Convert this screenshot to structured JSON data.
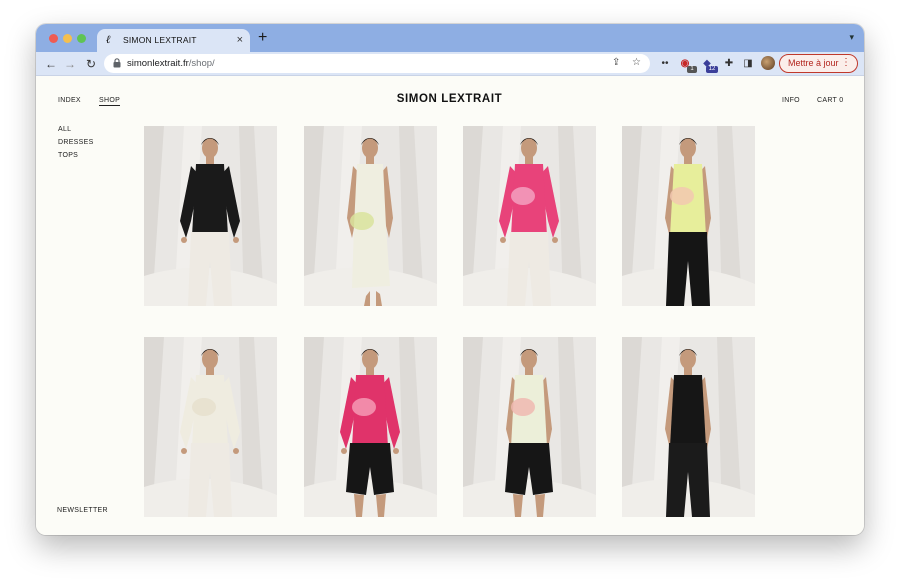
{
  "browser": {
    "tab_title": "SIMON LEXTRAIT",
    "url_host": "simonlextrait.fr",
    "url_path": "/shop/",
    "update_label": "Mettre à jour",
    "extension_badges": [
      "1",
      "12"
    ]
  },
  "site": {
    "logo": "SIMON LEXTRAIT",
    "nav_left": [
      "INDEX",
      "SHOP"
    ],
    "nav_right": [
      "INFO",
      "CART 0"
    ],
    "categories": [
      "ALL",
      "DRESSES",
      "TOPS"
    ],
    "newsletter": "NEWSLETTER"
  },
  "products": [
    {
      "top": "black long-sleeve top",
      "bottom": "white trousers",
      "top_color": "#1a1a1a",
      "bottom_color": "#eeeae3",
      "accent": null
    },
    {
      "top": "cream sleeveless dress",
      "bottom": "",
      "top_color": "#efeee0",
      "bottom_color": "#efeee0",
      "accent": "#d9e39c"
    },
    {
      "top": "pink long-sleeve top",
      "bottom": "white trousers",
      "top_color": "#e8437a",
      "bottom_color": "#eeeae3",
      "accent": "#f3a0c0"
    },
    {
      "top": "yellow-green tank top",
      "bottom": "black trousers",
      "top_color": "#e7ee9b",
      "bottom_color": "#151515",
      "accent": "#f2c8b0"
    },
    {
      "top": "cream long-sleeve top",
      "bottom": "white trousers",
      "top_color": "#efece0",
      "bottom_color": "#eeeae3",
      "accent": "#e6e0cc"
    },
    {
      "top": "magenta long-sleeve top",
      "bottom": "black shorts",
      "top_color": "#e0336a",
      "bottom_color": "#161616",
      "accent": "#f49ab4"
    },
    {
      "top": "cream tank top",
      "bottom": "black shorts",
      "top_color": "#ecefd9",
      "bottom_color": "#161616",
      "accent": "#f0b8b0"
    },
    {
      "top": "black tank top",
      "bottom": "black trousers",
      "top_color": "#161616",
      "bottom_color": "#1b1b1b",
      "accent": null
    }
  ]
}
